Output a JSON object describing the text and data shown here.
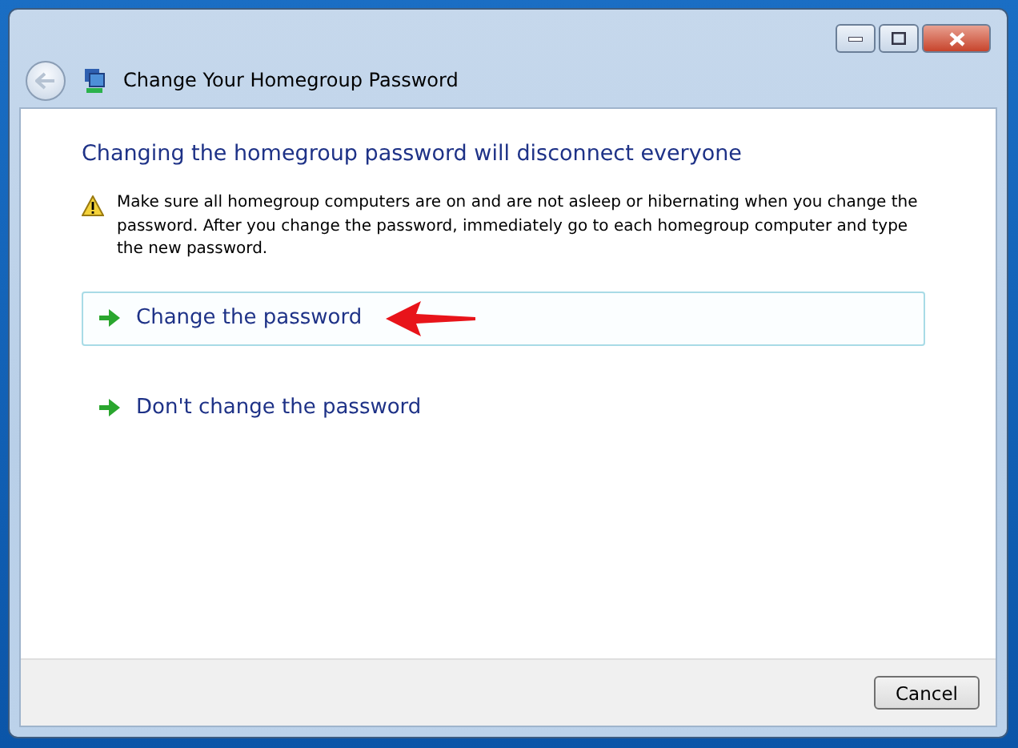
{
  "window": {
    "title": "Change Your Homegroup Password"
  },
  "heading": "Changing the homegroup password will disconnect everyone",
  "warning": "Make sure all homegroup computers are on and are not asleep or hibernating when you change the password. After you change the password, immediately go to each homegroup computer and type the new password.",
  "options": [
    {
      "label": "Change the password",
      "selected": true
    },
    {
      "label": "Don't change the password",
      "selected": false
    }
  ],
  "buttons": [
    "Cancel"
  ]
}
